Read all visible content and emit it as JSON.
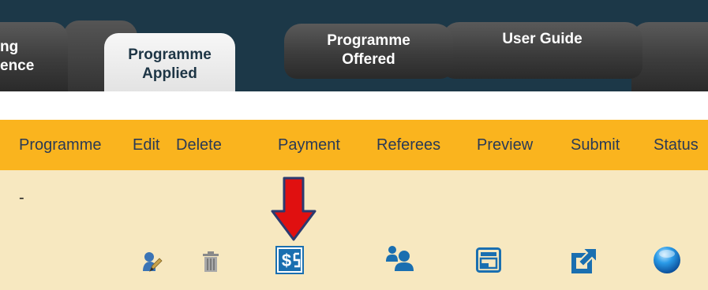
{
  "tabs": [
    {
      "line1": "ng",
      "line2": "ence",
      "active": false
    },
    {
      "line1": "Programme",
      "line2": "Applied",
      "active": true
    },
    {
      "line1": "Programme",
      "line2": "Offered",
      "active": false
    },
    {
      "line1": "User Guide",
      "line2": "",
      "active": false
    }
  ],
  "menu": {
    "items": [
      "Programme",
      "Edit",
      "Delete",
      "Payment",
      "Referees",
      "Preview",
      "Submit",
      "Status"
    ]
  },
  "row": {
    "programme_value": "-"
  },
  "icons": {
    "edit": "edit-user-icon",
    "delete": "trash-icon",
    "payment": "payment-dollar-icon",
    "referees": "referees-people-icon",
    "preview": "preview-form-icon",
    "submit": "submit-external-icon",
    "status": "status-blue-orb-icon"
  },
  "colors": {
    "tabbar_bg": "#1c3848",
    "menubar_bg": "#fab41e",
    "row_bg": "#f7e8c0",
    "icon_blue": "#1a6fb0",
    "annotation_arrow": "#e01010"
  }
}
